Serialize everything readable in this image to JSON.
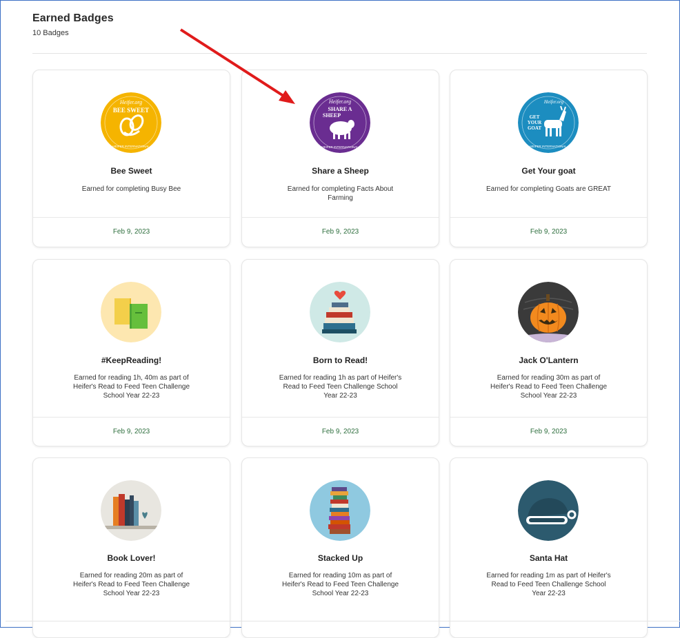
{
  "header": {
    "title": "Earned Badges",
    "count": "10 Badges"
  },
  "badges": [
    {
      "title": "Bee Sweet",
      "description": "Earned for completing Busy Bee",
      "date": "Feb 9, 2023",
      "icon": "bee-sweet-badge-icon",
      "icon_text_top": "Heifer.org",
      "icon_text_main": "BEE SWEET",
      "icon_text_ring": "HEIFER INTERNATIONAL",
      "color": "#f5b400"
    },
    {
      "title": "Share a Sheep",
      "description": "Earned for completing Facts About Farming",
      "date": "Feb 9, 2023",
      "icon": "share-a-sheep-badge-icon",
      "icon_text_top": "Heifer.org",
      "icon_text_main_1": "SHARE A",
      "icon_text_main_2": "SHEEP",
      "icon_text_ring": "HEIFER INTERNATIONAL",
      "color": "#6a2d91"
    },
    {
      "title": "Get Your goat",
      "description": "Earned for completing Goats are GREAT",
      "date": "Feb 9, 2023",
      "icon": "get-your-goat-badge-icon",
      "icon_text_top": "Heifer.org",
      "icon_text_main_1": "GET",
      "icon_text_main_2": "YOUR",
      "icon_text_main_3": "GOAT",
      "icon_text_ring": "HEIFER INTERNATIONAL",
      "color": "#1c8dc0"
    },
    {
      "title": "#KeepReading!",
      "description": "Earned for reading 1h, 40m as part of Heifer's Read to Feed Teen Challenge School Year 22-23",
      "date": "Feb 9, 2023",
      "icon": "green-books-icon",
      "color": "#fde7b0"
    },
    {
      "title": "Born to Read!",
      "description": "Earned for reading 1h as part of Heifer's Read to Feed Teen Challenge School Year 22-23",
      "date": "Feb 9, 2023",
      "icon": "book-stack-heart-icon",
      "color": "#cfe9e6"
    },
    {
      "title": "Jack O'Lantern",
      "description": "Earned for reading 30m as part of Heifer's Read to Feed Teen Challenge School Year 22-23",
      "date": "Feb 9, 2023",
      "icon": "pumpkin-icon",
      "color": "#3a3a3a"
    },
    {
      "title": "Book Lover!",
      "description": "Earned for reading 20m as part of Heifer's Read to Feed Teen Challenge School Year 22-23",
      "date": "",
      "icon": "bookshelf-heart-icon",
      "color": "#e8e6e0"
    },
    {
      "title": "Stacked Up",
      "description": "Earned for reading 10m as part of Heifer's Read to Feed Teen Challenge School Year 22-23",
      "date": "",
      "icon": "tall-book-stack-icon",
      "color": "#8fc9e0"
    },
    {
      "title": "Santa Hat",
      "description": "Earned for reading 1m as part of Heifer's Read to Feed Teen Challenge School Year 22-23",
      "date": "",
      "icon": "santa-hat-icon",
      "color": "#2c5a6e"
    }
  ],
  "colors": {
    "date_text": "#2d6e3d",
    "arrow": "#e01b1b",
    "frame": "#3c6fc4"
  }
}
